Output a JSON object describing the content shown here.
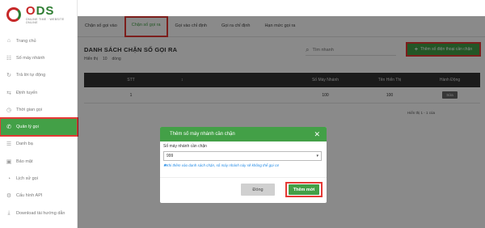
{
  "logo": {
    "word_o": "O",
    "word_ds": "DS",
    "tagline": "ONLINE TIME · WEBSITE ONLINE"
  },
  "sidebar": {
    "items": [
      {
        "label": "Trang chủ",
        "icon": "home-icon",
        "glyph": "⌂"
      },
      {
        "label": "Số máy nhánh",
        "icon": "extension-icon",
        "glyph": "☷"
      },
      {
        "label": "Trả lời tự động",
        "icon": "auto-reply-icon",
        "glyph": "↻"
      },
      {
        "label": "Định tuyến",
        "icon": "route-icon",
        "glyph": "⇆"
      },
      {
        "label": "Thời gian gọi",
        "icon": "clock-icon",
        "glyph": "◷"
      },
      {
        "label": "Quản lý gọi",
        "icon": "phone-icon",
        "glyph": "✆",
        "active": true
      },
      {
        "label": "Danh bạ",
        "icon": "contacts-icon",
        "glyph": "☰"
      },
      {
        "label": "Bảo mật",
        "icon": "lock-icon",
        "glyph": "▣"
      },
      {
        "label": "Lịch sử gọi",
        "icon": "history-icon",
        "glyph": "◔"
      },
      {
        "label": "Cấu hình API",
        "icon": "api-icon",
        "glyph": "⚙"
      },
      {
        "label": "Download tài hướng dẫn",
        "icon": "download-icon",
        "glyph": "⤓"
      }
    ]
  },
  "tabs": [
    {
      "label": "Chặn số gọi vào"
    },
    {
      "label": "Chặn số gọi ra",
      "active": true
    },
    {
      "label": "Gọi vào chỉ định"
    },
    {
      "label": "Gọi ra chỉ định"
    },
    {
      "label": "Hạn mức gọi ra"
    }
  ],
  "main": {
    "title": "DANH SÁCH CHẶN SỐ GỌI RA",
    "show_prefix": "Hiển thị",
    "show_count": "10",
    "show_suffix": "dòng",
    "search_placeholder": "Tìm nhanh",
    "add_phone_label": "Thêm số điện thoại cần chặn",
    "pager_info": "Hiển thị 1 - 1 của"
  },
  "table": {
    "headers": [
      "STT",
      "↕",
      "Số Máy Nhánh",
      "Tên Hiển Thị",
      "Hành Động"
    ],
    "rows": [
      {
        "stt": "1",
        "ext": "100",
        "name": "100",
        "action": "Sửa"
      }
    ]
  },
  "modal": {
    "title": "Thêm số máy nhánh cần chặn",
    "close": "✕",
    "field_label": "Số máy nhánh cần chặn",
    "selected": "999",
    "note": "✱Khi thêm vào danh sách chặn, số máy nhánh này sẽ không thể gọi ra!",
    "close_button": "Đóng",
    "add_button": "Thêm mới"
  },
  "colors": {
    "accent": "#43a047",
    "highlight": "#e53935",
    "header_dark": "#333333",
    "note_blue": "#1e88e5"
  }
}
